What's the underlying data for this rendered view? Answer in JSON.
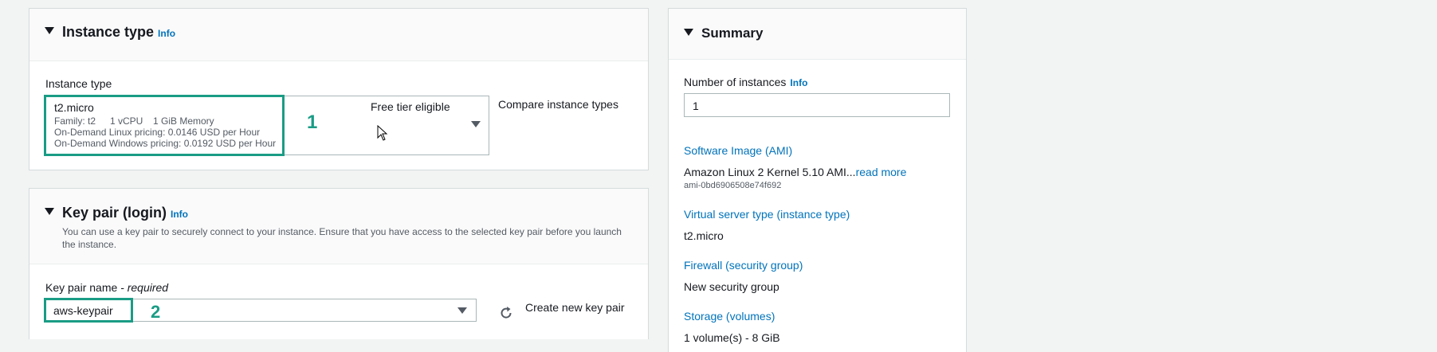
{
  "instance_section": {
    "title": "Instance type",
    "info": "Info",
    "field_label": "Instance type",
    "selected": {
      "name": "t2.micro",
      "family": "Family: t2",
      "vcpu": "1 vCPU",
      "memory": "1 GiB Memory",
      "linux_pricing": "On-Demand Linux pricing: 0.0146 USD per Hour",
      "windows_pricing": "On-Demand Windows pricing: 0.0192 USD per Hour"
    },
    "badge": "Free tier eligible",
    "compare_link": "Compare instance types",
    "annotation": "1"
  },
  "key_section": {
    "title": "Key pair (login)",
    "info": "Info",
    "description": "You can use a key pair to securely connect to your instance. Ensure that you have access to the selected key pair before you launch the instance.",
    "field_label": "Key pair name",
    "required_label": "- required",
    "value": "aws-keypair",
    "create_link": "Create new key pair",
    "annotation": "2",
    "refresh_icon": "refresh-icon"
  },
  "summary": {
    "title": "Summary",
    "num_instances_label": "Number of instances",
    "info": "Info",
    "num_instances_value": "1",
    "ami_label": "Software Image (AMI)",
    "ami_value": "Amazon Linux 2 Kernel 5.10 AMI...",
    "read_more": "read more",
    "ami_id": "ami-0bd6906508e74f692",
    "instance_type_label": "Virtual server type (instance type)",
    "instance_type_value": "t2.micro",
    "firewall_label": "Firewall (security group)",
    "firewall_value": "New security group",
    "storage_label": "Storage (volumes)",
    "storage_value": "1 volume(s) - 8 GiB"
  },
  "colors": {
    "accent": "#1a9c85",
    "link": "#0073bb"
  }
}
